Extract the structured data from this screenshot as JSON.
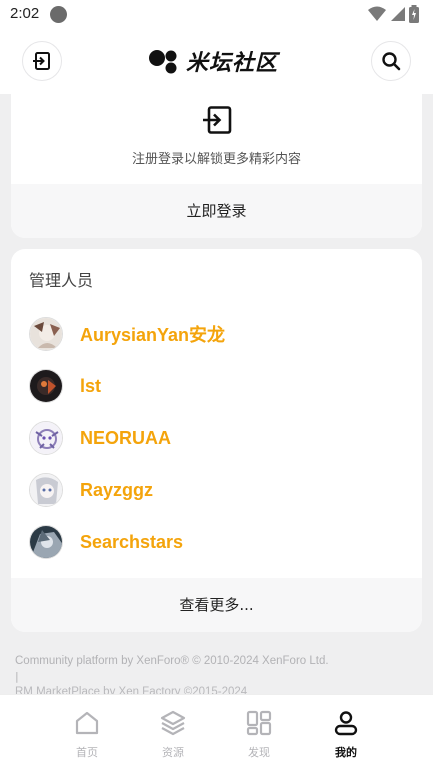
{
  "status_bar": {
    "time": "2:02"
  },
  "header": {
    "logo_text": "米坛社区"
  },
  "login_card": {
    "tip": "注册登录以解锁更多精彩内容",
    "button_label": "立即登录"
  },
  "staff": {
    "title": "管理人员",
    "members": [
      {
        "name": "AurysianYan安龙"
      },
      {
        "name": "lst"
      },
      {
        "name": "NEORUAA"
      },
      {
        "name": "Rayzggz"
      },
      {
        "name": "Searchstars"
      }
    ],
    "more_label": "查看更多..."
  },
  "footer": {
    "line1": "Community platform by XenForo® © 2010-2024 XenForo Ltd.",
    "separator": "|",
    "line2": "RM MarketPlace by Xen Factory ©2015-2024"
  },
  "nav": {
    "items": [
      {
        "label": "首页",
        "icon": "home-icon"
      },
      {
        "label": "资源",
        "icon": "layers-icon"
      },
      {
        "label": "发现",
        "icon": "grid-icon"
      },
      {
        "label": "我的",
        "icon": "user-icon"
      }
    ],
    "active_index": 3
  },
  "colors": {
    "accent": "#f4a40c",
    "background": "#efeff0"
  }
}
